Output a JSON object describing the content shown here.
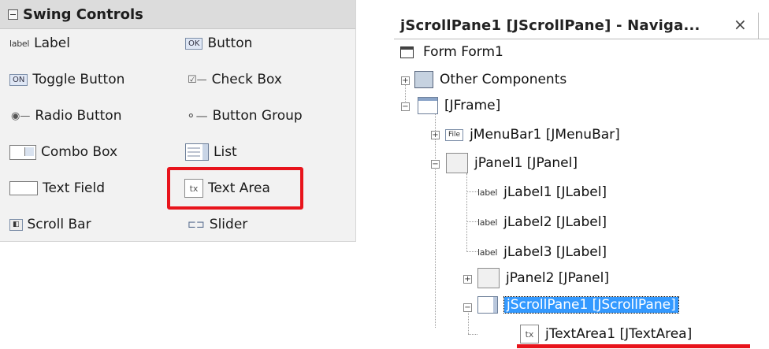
{
  "palette": {
    "title": "Swing Controls",
    "items": [
      {
        "label": "Label",
        "icon_text": "label"
      },
      {
        "label": "Button",
        "icon_text": "OK"
      },
      {
        "label": "Toggle Button",
        "icon_text": "ON"
      },
      {
        "label": "Check Box",
        "icon_text": "☑—"
      },
      {
        "label": "Radio Button",
        "icon_text": "◉—"
      },
      {
        "label": "Button Group",
        "icon_text": "⚬—"
      },
      {
        "label": "Combo Box",
        "icon_text": ""
      },
      {
        "label": "List",
        "icon_text": ""
      },
      {
        "label": "Text Field",
        "icon_text": ""
      },
      {
        "label": "Text Area",
        "icon_text": "tx"
      },
      {
        "label": "Scroll Bar",
        "icon_text": "◧"
      },
      {
        "label": "Slider",
        "icon_text": "⊏⊐"
      }
    ]
  },
  "navigator": {
    "title": "jScrollPane1 [JScrollPane] - Naviga...",
    "close": "×",
    "nodes": [
      {
        "label": "Form Form1"
      },
      {
        "label": "Other Components"
      },
      {
        "label": "[JFrame]"
      },
      {
        "label": "jMenuBar1 [JMenuBar]",
        "icon_text": "File"
      },
      {
        "label": "jPanel1 [JPanel]"
      },
      {
        "label": "jLabel1 [JLabel]",
        "icon_text": "label"
      },
      {
        "label": "jLabel2 [JLabel]",
        "icon_text": "label"
      },
      {
        "label": "jLabel3 [JLabel]",
        "icon_text": "label"
      },
      {
        "label": "jPanel2 [JPanel]"
      },
      {
        "label": "jScrollPane1 [JScrollPane]"
      },
      {
        "label": "jTextArea1 [JTextArea]",
        "icon_text": "tx"
      }
    ],
    "expanders": {
      "plus": "+",
      "minus": "−"
    }
  },
  "colors": {
    "highlight": "#e8141c",
    "selection": "#3399ff"
  }
}
